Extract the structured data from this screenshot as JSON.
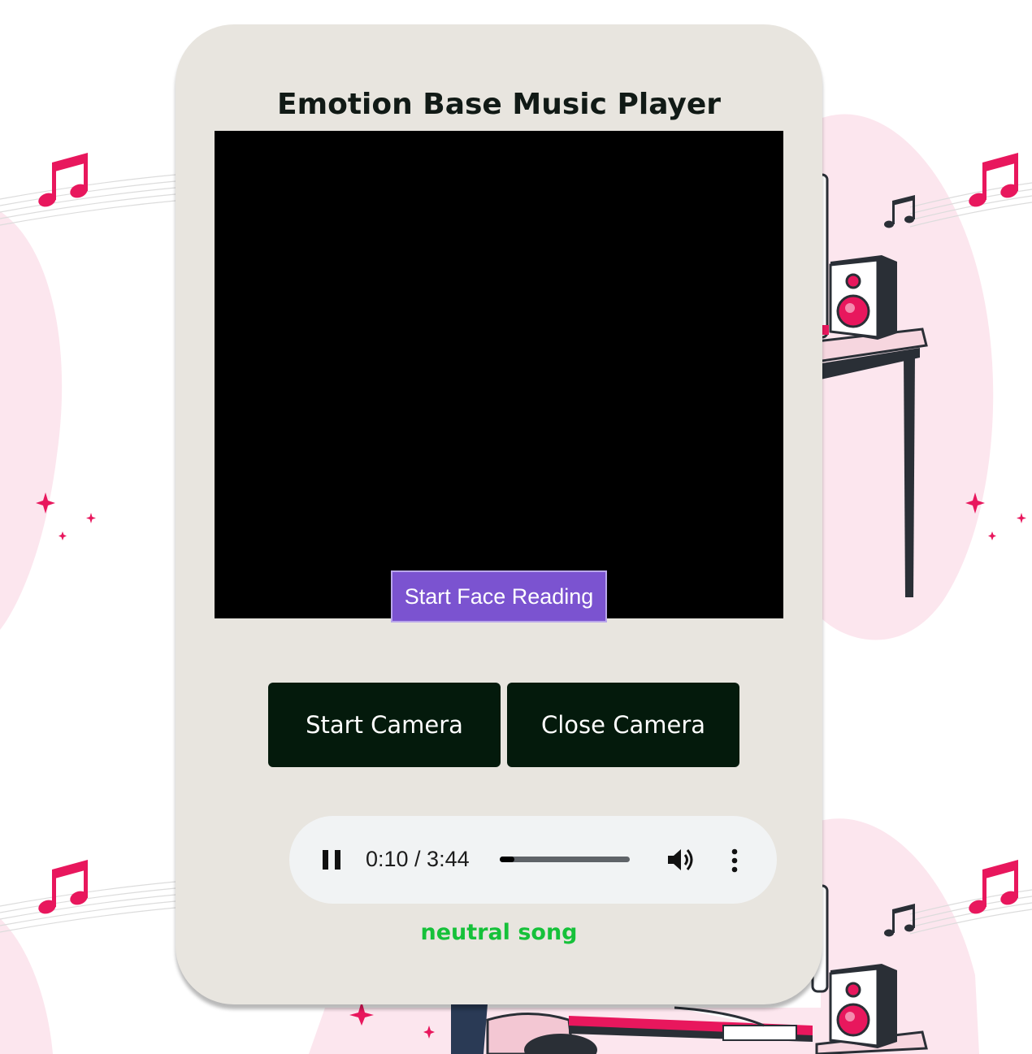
{
  "app": {
    "title": "Emotion Base Music Player"
  },
  "video": {
    "face_button_label": "Start Face Reading"
  },
  "camera": {
    "start_label": "Start Camera",
    "close_label": "Close Camera"
  },
  "audio": {
    "state": "playing",
    "time_text": "0:10 / 3:44",
    "progress": 0.045,
    "pause_icon": "pause-icon",
    "volume_icon": "volume-icon",
    "more_icon": "more-options-icon"
  },
  "status": {
    "song_label": "neutral song"
  },
  "colors": {
    "accent_pink": "#e8175d",
    "card_bg": "#e8e5df",
    "camera_button_bg": "#041a0c",
    "face_button_bg": "#7b53d0",
    "song_label_color": "#16c13a"
  }
}
